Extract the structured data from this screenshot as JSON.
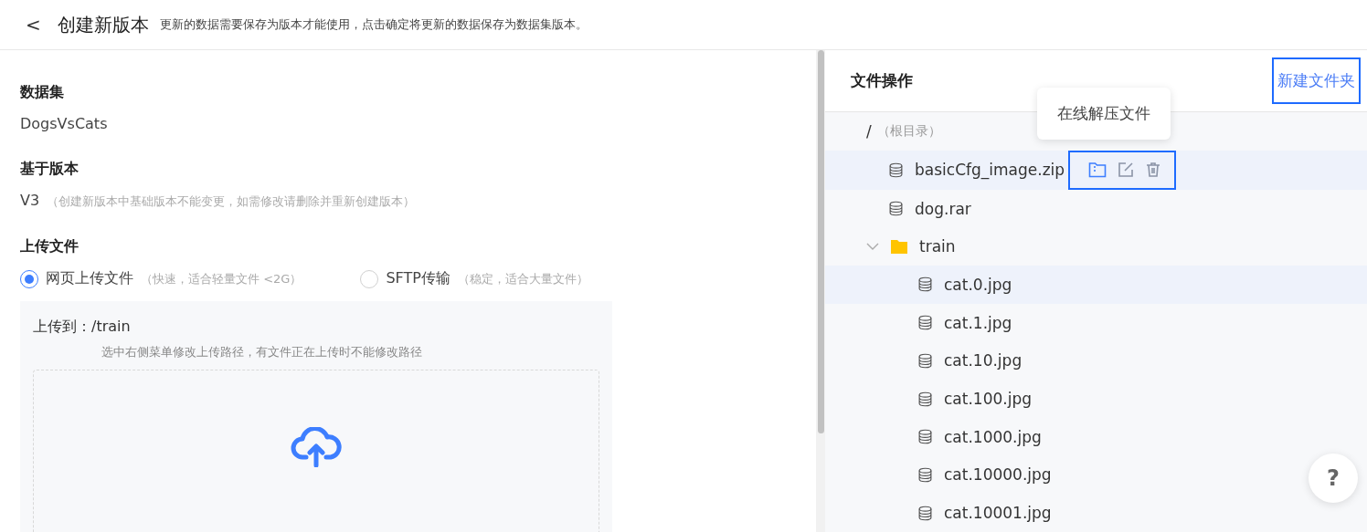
{
  "header": {
    "back_icon": "<",
    "title": "创建新版本",
    "description": "更新的数据需要保存为版本才能使用，点击确定将更新的数据保存为数据集版本。"
  },
  "form": {
    "dataset": {
      "label": "数据集",
      "value": "DogsVsCats"
    },
    "base_version": {
      "label": "基于版本",
      "value": "V3",
      "note": "（创建新版本中基础版本不能变更，如需修改请删除并重新创建版本）"
    },
    "upload": {
      "label": "上传文件",
      "methods": [
        {
          "label": "网页上传文件",
          "note": "（快速，适合轻量文件 <2G）",
          "selected": true
        },
        {
          "label": "SFTP传输",
          "note": "（稳定，适合大量文件）",
          "selected": false
        }
      ],
      "target_label": "上传到：",
      "target_path": "/train",
      "hint": "选中右侧菜单修改上传路径，有文件正在上传时不能修改路径"
    }
  },
  "file_panel": {
    "title": "文件操作",
    "new_folder": "新建文件夹",
    "tree": {
      "name": "/",
      "note": "（根目录）",
      "children": [
        {
          "name": "basicCfg_image.zip",
          "kind": "file",
          "selected": false,
          "hovered": true,
          "tooltip": "在线解压文件"
        },
        {
          "name": "dog.rar",
          "kind": "file",
          "selected": false,
          "hovered": false
        },
        {
          "name": "train",
          "kind": "folder",
          "expanded": true,
          "selected": false,
          "hovered": false,
          "children": [
            {
              "name": "cat.0.jpg",
              "kind": "file",
              "selected": true,
              "hovered": false
            },
            {
              "name": "cat.1.jpg",
              "kind": "file",
              "selected": false,
              "hovered": false
            },
            {
              "name": "cat.10.jpg",
              "kind": "file",
              "selected": false,
              "hovered": false
            },
            {
              "name": "cat.100.jpg",
              "kind": "file",
              "selected": false,
              "hovered": false
            },
            {
              "name": "cat.1000.jpg",
              "kind": "file",
              "selected": false,
              "hovered": false
            },
            {
              "name": "cat.10000.jpg",
              "kind": "file",
              "selected": false,
              "hovered": false
            },
            {
              "name": "cat.10001.jpg",
              "kind": "file",
              "selected": false,
              "hovered": false
            }
          ]
        }
      ]
    }
  },
  "help_button": "?"
}
